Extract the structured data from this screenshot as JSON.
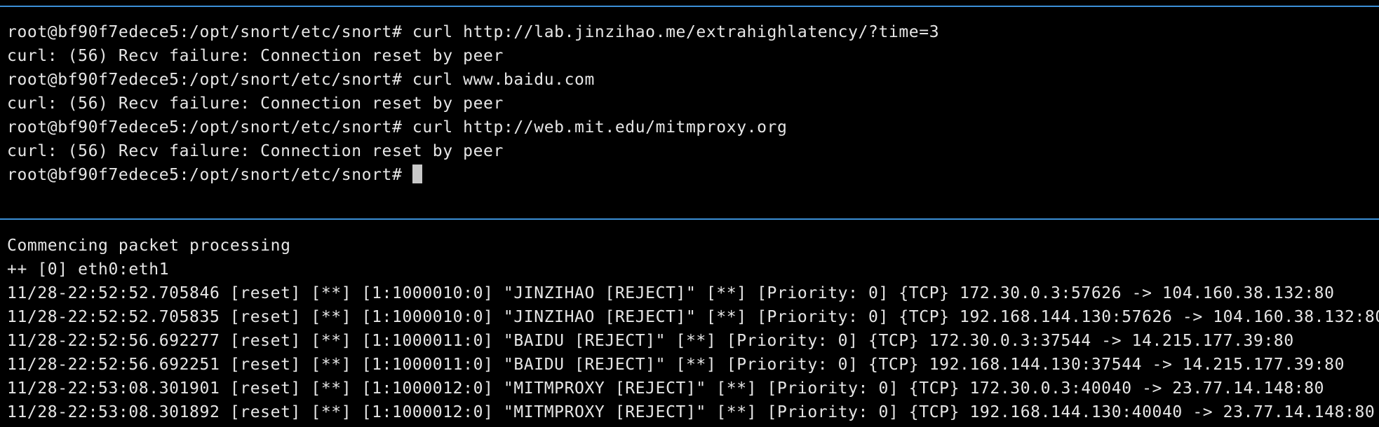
{
  "colors": {
    "background": "#000000",
    "text": "#e6e6e6",
    "divider": "#3b8fd6",
    "cursor": "#c8c8c8"
  },
  "top_pane": {
    "lines": [
      "root@bf90f7edece5:/opt/snort/etc/snort# curl http://lab.jinzihao.me/extrahighlatency/?time=3",
      "curl: (56) Recv failure: Connection reset by peer",
      "root@bf90f7edece5:/opt/snort/etc/snort# curl www.baidu.com",
      "curl: (56) Recv failure: Connection reset by peer",
      "root@bf90f7edece5:/opt/snort/etc/snort# curl http://web.mit.edu/mitmproxy.org",
      "curl: (56) Recv failure: Connection reset by peer"
    ],
    "prompt": "root@bf90f7edece5:/opt/snort/etc/snort# "
  },
  "bottom_pane": {
    "lines": [
      "Commencing packet processing",
      "++ [0] eth0:eth1",
      "11/28-22:52:52.705846 [reset] [**] [1:1000010:0] \"JINZIHAO [REJECT]\" [**] [Priority: 0] {TCP} 172.30.0.3:57626 -> 104.160.38.132:80",
      "11/28-22:52:52.705835 [reset] [**] [1:1000010:0] \"JINZIHAO [REJECT]\" [**] [Priority: 0] {TCP} 192.168.144.130:57626 -> 104.160.38.132:80",
      "11/28-22:52:56.692277 [reset] [**] [1:1000011:0] \"BAIDU [REJECT]\" [**] [Priority: 0] {TCP} 172.30.0.3:37544 -> 14.215.177.39:80",
      "11/28-22:52:56.692251 [reset] [**] [1:1000011:0] \"BAIDU [REJECT]\" [**] [Priority: 0] {TCP} 192.168.144.130:37544 -> 14.215.177.39:80",
      "11/28-22:53:08.301901 [reset] [**] [1:1000012:0] \"MITMPROXY [REJECT]\" [**] [Priority: 0] {TCP} 172.30.0.3:40040 -> 23.77.14.148:80",
      "11/28-22:53:08.301892 [reset] [**] [1:1000012:0] \"MITMPROXY [REJECT]\" [**] [Priority: 0] {TCP} 192.168.144.130:40040 -> 23.77.14.148:80"
    ]
  }
}
